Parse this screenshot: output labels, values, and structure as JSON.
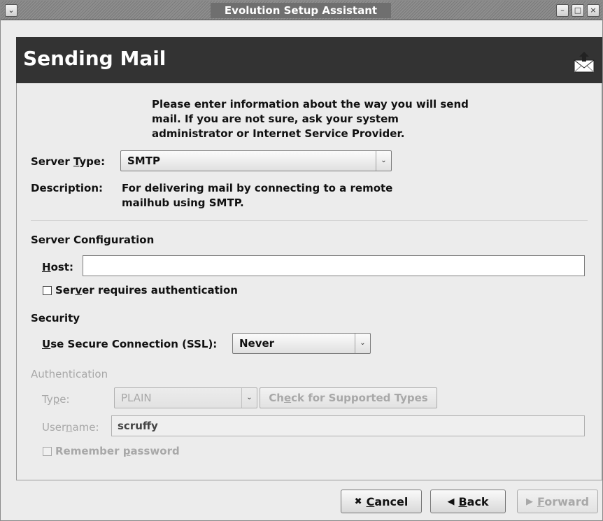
{
  "window": {
    "title": "Evolution Setup Assistant",
    "menu_symbol": "⌄",
    "minimize_symbol": "–",
    "maximize_symbol": "□",
    "close_symbol": "×"
  },
  "header": {
    "title": "Sending Mail",
    "icon": "envelope-send-icon"
  },
  "intro": "Please enter information about the way you will send mail. If you are not sure, ask your system administrator or Internet Service Provider.",
  "server_type": {
    "label_pre": "Server ",
    "label_u": "T",
    "label_post": "ype:",
    "value": "SMTP"
  },
  "description": {
    "label": "Description:",
    "text": "For delivering mail by connecting to a remote mailhub using SMTP."
  },
  "server_config": {
    "heading": "Server Configuration",
    "host_label_u": "H",
    "host_label_post": "ost:",
    "host_value": "",
    "auth_check_pre": "Ser",
    "auth_check_u": "v",
    "auth_check_post": "er requires authentication",
    "auth_checked": false
  },
  "security": {
    "heading": "Security",
    "ssl_label_u": "U",
    "ssl_label_post": "se Secure Connection (SSL):",
    "ssl_value": "Never"
  },
  "authentication": {
    "heading": "Authentication",
    "type_label_pre": "Ty",
    "type_label_u": "p",
    "type_label_post": "e:",
    "type_value": "PLAIN",
    "check_button_pre": "Ch",
    "check_button_u": "e",
    "check_button_post": "ck for Supported Types",
    "username_label_pre": "User",
    "username_label_u": "n",
    "username_label_post": "ame:",
    "username_value": "scruffy",
    "remember_pre": "Remember ",
    "remember_u": "p",
    "remember_post": "assword",
    "remember_checked": false
  },
  "buttons": {
    "cancel_icon": "✖",
    "cancel_u": "C",
    "cancel_post": "ancel",
    "back_icon": "◀",
    "back_u": "B",
    "back_post": "ack",
    "forward_icon": "▶",
    "forward_u": "F",
    "forward_post": "orward"
  }
}
